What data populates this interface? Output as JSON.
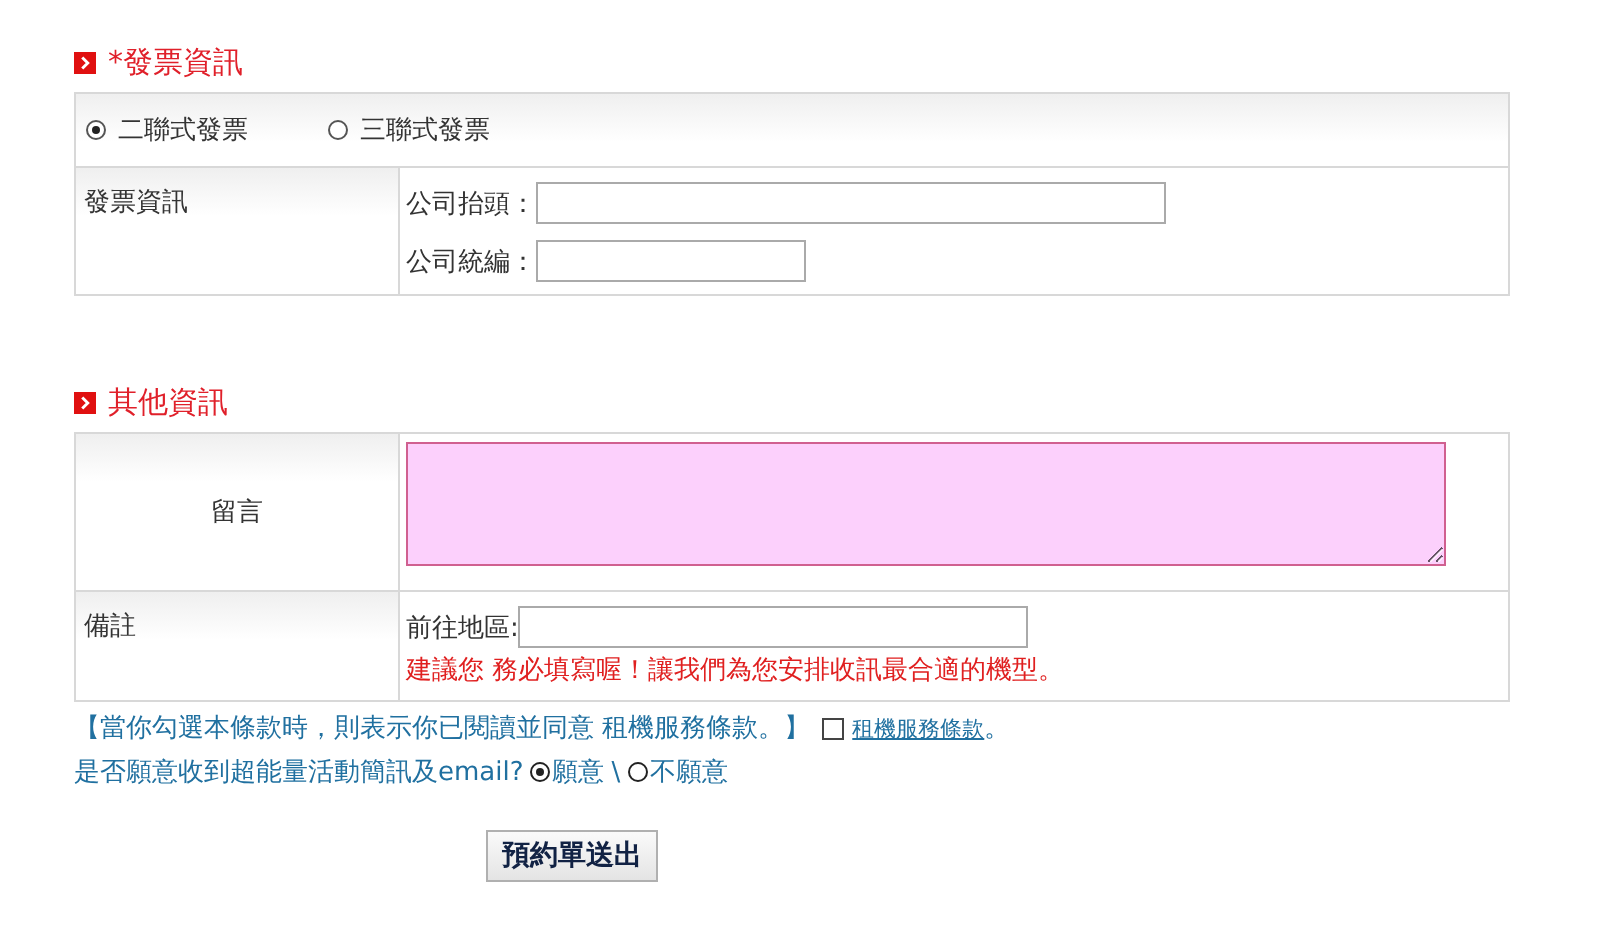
{
  "invoice": {
    "title": "*發票資訊",
    "types": [
      {
        "label": "二聯式發票",
        "selected": true
      },
      {
        "label": "三聯式發票",
        "selected": false
      }
    ],
    "row_label": "發票資訊",
    "fields": [
      {
        "label": "公司抬頭：",
        "kind": "long"
      },
      {
        "label": "公司統編：",
        "kind": "short"
      }
    ]
  },
  "other": {
    "title": "其他資訊",
    "message_label": "留言",
    "note_label": "備註",
    "region_label": "前往地區:",
    "hint": "建議您 務必填寫喔！讓我們為您安排收訊最合適的機型。"
  },
  "terms": {
    "text": "【當你勾選本條款時，則表示你已閱讀並同意 租機服務條款。】",
    "checked": false,
    "link": "租機服務條款",
    "after": "。"
  },
  "email": {
    "question": "是否願意收到超能量活動簡訊及email?",
    "separator": "\\",
    "options": [
      {
        "label": "願意",
        "selected": true
      },
      {
        "label": "不願意",
        "selected": false
      }
    ]
  },
  "submit": "預約單送出"
}
